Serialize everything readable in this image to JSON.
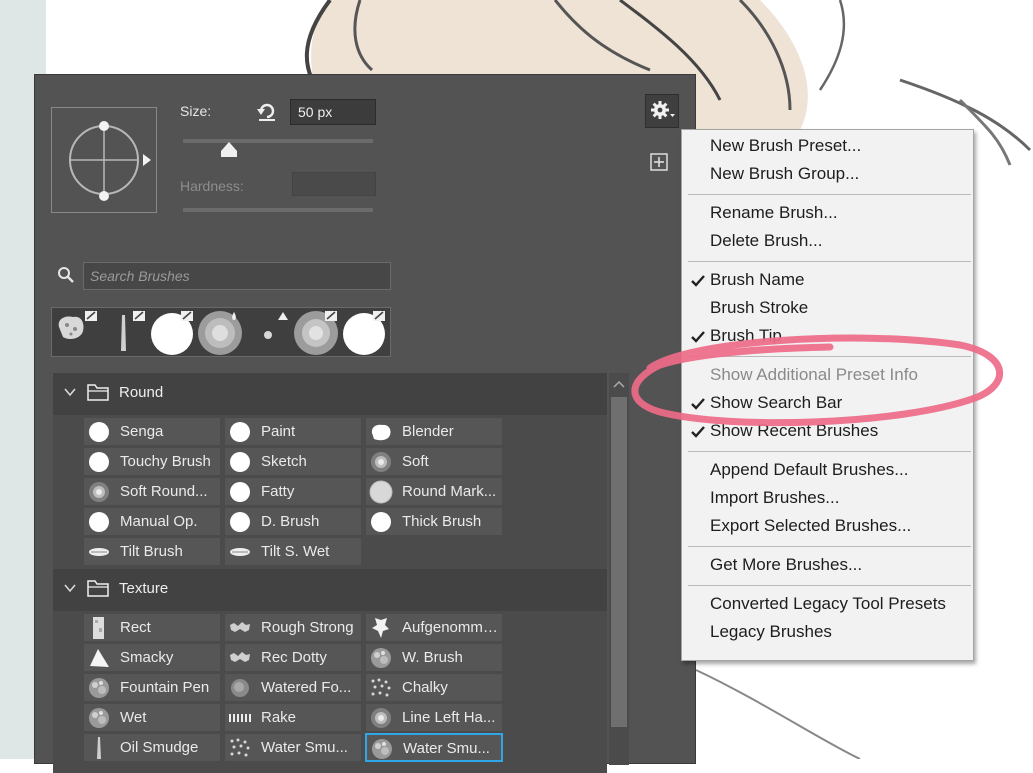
{
  "panel": {
    "size_label": "Size:",
    "size_value": "50 px",
    "hardness_label": "Hardness:",
    "size_level": 0.25,
    "search_placeholder": "Search Brushes",
    "gear_icon": "gear-icon",
    "recent_brushes": [
      "texture-brush",
      "streak-brush",
      "hard-round",
      "soft-round",
      "small-soft-round",
      "soft-round-large",
      "hard-round-large"
    ]
  },
  "groups": [
    {
      "name": "Round",
      "brushes": [
        {
          "label": "Senga",
          "thumb": "hard"
        },
        {
          "label": "Paint",
          "thumb": "hard"
        },
        {
          "label": "Blender",
          "thumb": "blob"
        },
        {
          "label": "Touchy Brush",
          "thumb": "hard"
        },
        {
          "label": "Sketch",
          "thumb": "hard"
        },
        {
          "label": "Soft",
          "thumb": "soft"
        },
        {
          "label": "Soft Round...",
          "thumb": "soft"
        },
        {
          "label": "Fatty",
          "thumb": "hard"
        },
        {
          "label": "Round Mark...",
          "thumb": "grey"
        },
        {
          "label": "Manual Op.",
          "thumb": "hard"
        },
        {
          "label": "D. Brush",
          "thumb": "hard"
        },
        {
          "label": "Thick Brush",
          "thumb": "hard"
        },
        {
          "label": "Tilt Brush",
          "thumb": "tilt"
        },
        {
          "label": "Tilt S. Wet",
          "thumb": "tilt"
        }
      ]
    },
    {
      "name": "Texture",
      "brushes": [
        {
          "label": "Rect",
          "thumb": "rect"
        },
        {
          "label": "Rough Strong",
          "thumb": "rough"
        },
        {
          "label": "Aufgenomm…",
          "thumb": "splat"
        },
        {
          "label": "Smacky",
          "thumb": "tri"
        },
        {
          "label": "Rec Dotty",
          "thumb": "rough"
        },
        {
          "label": "W. Brush",
          "thumb": "texture"
        },
        {
          "label": "Fountain Pen",
          "thumb": "texture"
        },
        {
          "label": "Watered Fo...",
          "thumb": "dark"
        },
        {
          "label": "Chalky",
          "thumb": "chalk"
        },
        {
          "label": "Wet",
          "thumb": "texture"
        },
        {
          "label": "Rake",
          "thumb": "rake"
        },
        {
          "label": "Line Left Ha...",
          "thumb": "soft"
        },
        {
          "label": "Oil Smudge",
          "thumb": "streak"
        },
        {
          "label": "Water Smu...",
          "thumb": "chalk"
        },
        {
          "label": "Water Smu...",
          "thumb": "texture"
        }
      ]
    }
  ],
  "menu": {
    "items": [
      {
        "label": "New Brush Preset...",
        "checked": false,
        "disabled": false
      },
      {
        "label": "New Brush Group...",
        "checked": false,
        "disabled": false
      },
      {
        "label": "Rename Brush...",
        "checked": false,
        "disabled": false
      },
      {
        "label": "Delete Brush...",
        "checked": false,
        "disabled": false
      },
      {
        "label": "Brush Name",
        "checked": true,
        "disabled": false
      },
      {
        "label": "Brush Stroke",
        "checked": false,
        "disabled": false
      },
      {
        "label": "Brush Tip",
        "checked": true,
        "disabled": false
      },
      {
        "label": "Show Additional Preset Info",
        "checked": false,
        "disabled": true
      },
      {
        "label": "Show Search Bar",
        "checked": true,
        "disabled": false
      },
      {
        "label": "Show Recent Brushes",
        "checked": true,
        "disabled": false
      },
      {
        "label": "Append Default Brushes...",
        "checked": false,
        "disabled": false
      },
      {
        "label": "Import Brushes...",
        "checked": false,
        "disabled": false
      },
      {
        "label": "Export Selected Brushes...",
        "checked": false,
        "disabled": false
      },
      {
        "label": "Get More Brushes...",
        "checked": false,
        "disabled": false
      },
      {
        "label": "Converted Legacy Tool Presets",
        "checked": false,
        "disabled": false
      },
      {
        "label": "Legacy Brushes",
        "checked": false,
        "disabled": false
      }
    ]
  },
  "colors": {
    "panel_bg": "#535353",
    "menu_bg": "#f2f2f2",
    "selection_outline": "#2fa6e6",
    "annotation": "#ee6b88"
  }
}
